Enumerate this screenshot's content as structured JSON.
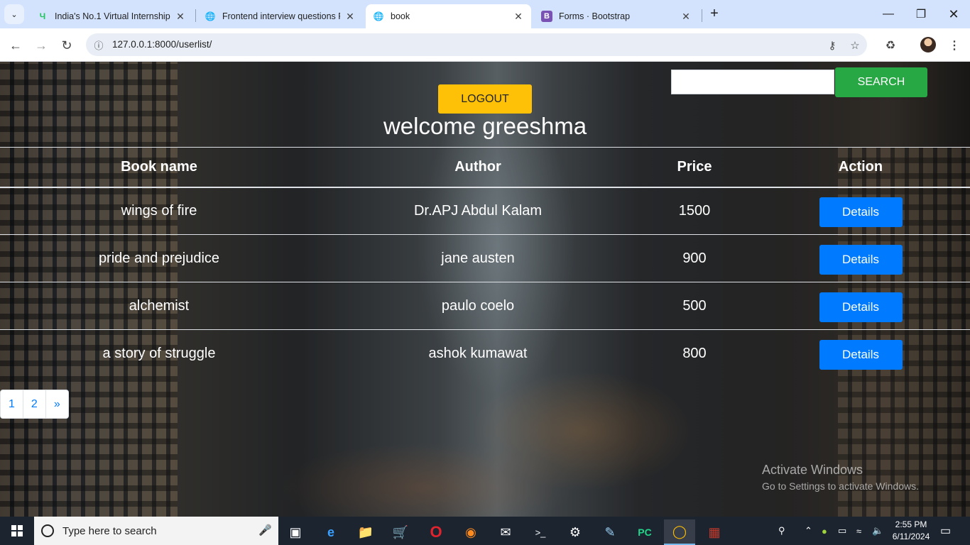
{
  "browser": {
    "tabs": [
      {
        "title": "India's No.1 Virtual Internship P",
        "favicon_color": "#22c55e",
        "active": false
      },
      {
        "title": "Frontend interview questions P",
        "favicon_color": "#444444",
        "active": false
      },
      {
        "title": "book",
        "favicon_color": "#444444",
        "active": true
      },
      {
        "title": "Forms · Bootstrap",
        "favicon_color": "#7952b3",
        "active": false
      }
    ],
    "url": "127.0.0.1:8000/userlist/"
  },
  "page": {
    "search_button": "SEARCH",
    "search_value": "",
    "logout_button": "LOGOUT",
    "welcome": "welcome greeshma",
    "table": {
      "headers": [
        "Book name",
        "Author",
        "Price",
        "Action"
      ],
      "rows": [
        {
          "name": "wings of fire",
          "author": "Dr.APJ Abdul Kalam",
          "price": "1500",
          "action": "Details"
        },
        {
          "name": "pride and prejudice",
          "author": "jane austen",
          "price": "900",
          "action": "Details"
        },
        {
          "name": "alchemist",
          "author": "paulo coelo",
          "price": "500",
          "action": "Details"
        },
        {
          "name": "a story of struggle",
          "author": "ashok kumawat",
          "price": "800",
          "action": "Details"
        }
      ]
    },
    "pagination": [
      "1",
      "2",
      "»"
    ],
    "watermark": {
      "line1": "Activate Windows",
      "line2": "Go to Settings to activate Windows."
    }
  },
  "taskbar": {
    "search_placeholder": "Type here to search",
    "time": "2:55 PM",
    "date": "6/11/2024"
  },
  "colors": {
    "search_button": "#28a745",
    "logout_button": "#ffc107",
    "details_button": "#007bff",
    "tabbar": "#d3e3fd"
  }
}
